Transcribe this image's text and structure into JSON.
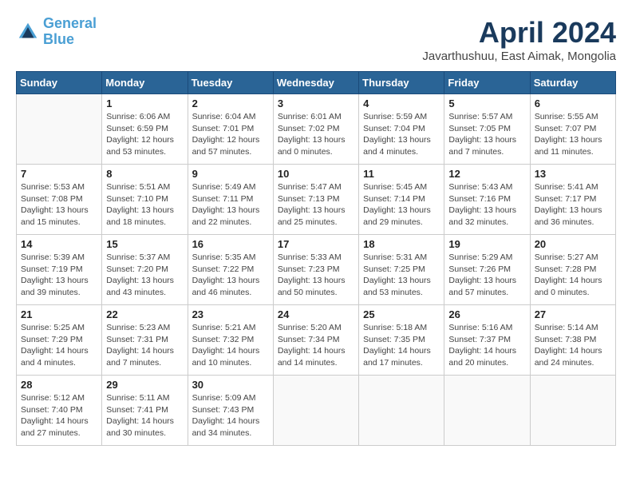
{
  "logo": {
    "line1": "General",
    "line2": "Blue"
  },
  "title": "April 2024",
  "location": "Javarthushuu, East Aimak, Mongolia",
  "days_of_week": [
    "Sunday",
    "Monday",
    "Tuesday",
    "Wednesday",
    "Thursday",
    "Friday",
    "Saturday"
  ],
  "weeks": [
    [
      {
        "day": "",
        "info": ""
      },
      {
        "day": "1",
        "info": "Sunrise: 6:06 AM\nSunset: 6:59 PM\nDaylight: 12 hours\nand 53 minutes."
      },
      {
        "day": "2",
        "info": "Sunrise: 6:04 AM\nSunset: 7:01 PM\nDaylight: 12 hours\nand 57 minutes."
      },
      {
        "day": "3",
        "info": "Sunrise: 6:01 AM\nSunset: 7:02 PM\nDaylight: 13 hours\nand 0 minutes."
      },
      {
        "day": "4",
        "info": "Sunrise: 5:59 AM\nSunset: 7:04 PM\nDaylight: 13 hours\nand 4 minutes."
      },
      {
        "day": "5",
        "info": "Sunrise: 5:57 AM\nSunset: 7:05 PM\nDaylight: 13 hours\nand 7 minutes."
      },
      {
        "day": "6",
        "info": "Sunrise: 5:55 AM\nSunset: 7:07 PM\nDaylight: 13 hours\nand 11 minutes."
      }
    ],
    [
      {
        "day": "7",
        "info": "Sunrise: 5:53 AM\nSunset: 7:08 PM\nDaylight: 13 hours\nand 15 minutes."
      },
      {
        "day": "8",
        "info": "Sunrise: 5:51 AM\nSunset: 7:10 PM\nDaylight: 13 hours\nand 18 minutes."
      },
      {
        "day": "9",
        "info": "Sunrise: 5:49 AM\nSunset: 7:11 PM\nDaylight: 13 hours\nand 22 minutes."
      },
      {
        "day": "10",
        "info": "Sunrise: 5:47 AM\nSunset: 7:13 PM\nDaylight: 13 hours\nand 25 minutes."
      },
      {
        "day": "11",
        "info": "Sunrise: 5:45 AM\nSunset: 7:14 PM\nDaylight: 13 hours\nand 29 minutes."
      },
      {
        "day": "12",
        "info": "Sunrise: 5:43 AM\nSunset: 7:16 PM\nDaylight: 13 hours\nand 32 minutes."
      },
      {
        "day": "13",
        "info": "Sunrise: 5:41 AM\nSunset: 7:17 PM\nDaylight: 13 hours\nand 36 minutes."
      }
    ],
    [
      {
        "day": "14",
        "info": "Sunrise: 5:39 AM\nSunset: 7:19 PM\nDaylight: 13 hours\nand 39 minutes."
      },
      {
        "day": "15",
        "info": "Sunrise: 5:37 AM\nSunset: 7:20 PM\nDaylight: 13 hours\nand 43 minutes."
      },
      {
        "day": "16",
        "info": "Sunrise: 5:35 AM\nSunset: 7:22 PM\nDaylight: 13 hours\nand 46 minutes."
      },
      {
        "day": "17",
        "info": "Sunrise: 5:33 AM\nSunset: 7:23 PM\nDaylight: 13 hours\nand 50 minutes."
      },
      {
        "day": "18",
        "info": "Sunrise: 5:31 AM\nSunset: 7:25 PM\nDaylight: 13 hours\nand 53 minutes."
      },
      {
        "day": "19",
        "info": "Sunrise: 5:29 AM\nSunset: 7:26 PM\nDaylight: 13 hours\nand 57 minutes."
      },
      {
        "day": "20",
        "info": "Sunrise: 5:27 AM\nSunset: 7:28 PM\nDaylight: 14 hours\nand 0 minutes."
      }
    ],
    [
      {
        "day": "21",
        "info": "Sunrise: 5:25 AM\nSunset: 7:29 PM\nDaylight: 14 hours\nand 4 minutes."
      },
      {
        "day": "22",
        "info": "Sunrise: 5:23 AM\nSunset: 7:31 PM\nDaylight: 14 hours\nand 7 minutes."
      },
      {
        "day": "23",
        "info": "Sunrise: 5:21 AM\nSunset: 7:32 PM\nDaylight: 14 hours\nand 10 minutes."
      },
      {
        "day": "24",
        "info": "Sunrise: 5:20 AM\nSunset: 7:34 PM\nDaylight: 14 hours\nand 14 minutes."
      },
      {
        "day": "25",
        "info": "Sunrise: 5:18 AM\nSunset: 7:35 PM\nDaylight: 14 hours\nand 17 minutes."
      },
      {
        "day": "26",
        "info": "Sunrise: 5:16 AM\nSunset: 7:37 PM\nDaylight: 14 hours\nand 20 minutes."
      },
      {
        "day": "27",
        "info": "Sunrise: 5:14 AM\nSunset: 7:38 PM\nDaylight: 14 hours\nand 24 minutes."
      }
    ],
    [
      {
        "day": "28",
        "info": "Sunrise: 5:12 AM\nSunset: 7:40 PM\nDaylight: 14 hours\nand 27 minutes."
      },
      {
        "day": "29",
        "info": "Sunrise: 5:11 AM\nSunset: 7:41 PM\nDaylight: 14 hours\nand 30 minutes."
      },
      {
        "day": "30",
        "info": "Sunrise: 5:09 AM\nSunset: 7:43 PM\nDaylight: 14 hours\nand 34 minutes."
      },
      {
        "day": "",
        "info": ""
      },
      {
        "day": "",
        "info": ""
      },
      {
        "day": "",
        "info": ""
      },
      {
        "day": "",
        "info": ""
      }
    ]
  ]
}
